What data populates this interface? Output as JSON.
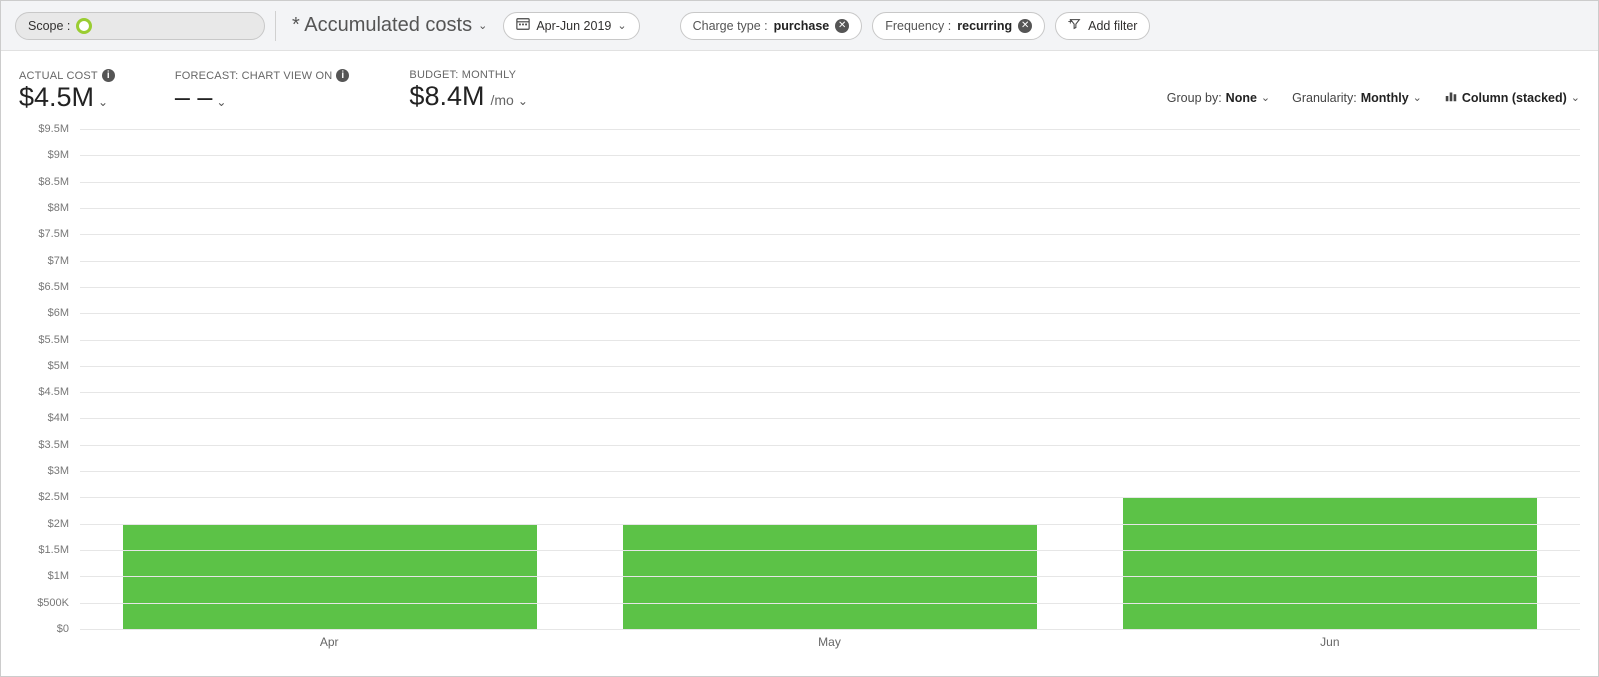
{
  "toolbar": {
    "scope_label": "Scope :",
    "view_title": "* Accumulated costs",
    "date_range": "Apr-Jun 2019",
    "filters": [
      {
        "label": "Charge type :",
        "value": "purchase"
      },
      {
        "label": "Frequency :",
        "value": "recurring"
      }
    ],
    "add_filter_label": "Add filter"
  },
  "kpis": {
    "actual": {
      "label": "ACTUAL COST",
      "value": "$4.5M"
    },
    "forecast": {
      "label": "FORECAST: CHART VIEW ON",
      "value": "– –"
    },
    "budget": {
      "label": "BUDGET: MONTHLY",
      "value": "$8.4M",
      "unit": "/mo"
    }
  },
  "view_options": {
    "groupby_label": "Group by:",
    "groupby_value": "None",
    "granularity_label": "Granularity:",
    "granularity_value": "Monthly",
    "charttype_value": "Column (stacked)"
  },
  "y_ticks": [
    "$9.5M",
    "$9M",
    "$8.5M",
    "$8M",
    "$7.5M",
    "$7M",
    "$6.5M",
    "$6M",
    "$5.5M",
    "$5M",
    "$4.5M",
    "$4M",
    "$3.5M",
    "$3M",
    "$2.5M",
    "$2M",
    "$1.5M",
    "$1M",
    "$500K",
    "$0"
  ],
  "chart_data": {
    "type": "bar",
    "title": "Accumulated costs",
    "xlabel": "",
    "ylabel": "",
    "ylim": [
      0,
      9500000
    ],
    "categories": [
      "Apr",
      "May",
      "Jun"
    ],
    "values": [
      2000000,
      2000000,
      2500000
    ],
    "color": "#5cc247"
  }
}
